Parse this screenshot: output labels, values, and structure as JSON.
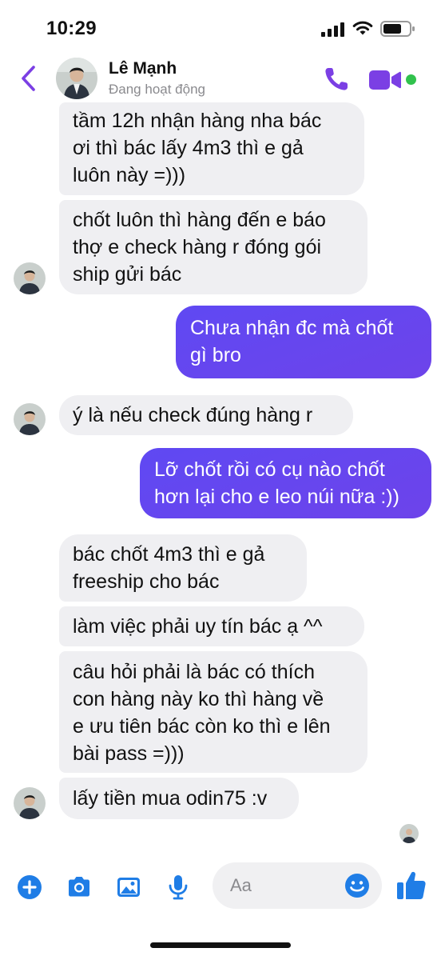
{
  "status_bar": {
    "time": "10:29"
  },
  "header": {
    "contact_name": "Lê Mạnh",
    "contact_status": "Đang hoạt động"
  },
  "messages": [
    {
      "from": "contact",
      "text": "tầm 12h nhận hàng nha bác\nơi thì bác lấy 4m3 thì e gả\nluôn này =)))"
    },
    {
      "from": "contact",
      "text": "chốt luôn thì hàng đến e báo\nthợ e check hàng r đóng gói\nship gửi bác"
    },
    {
      "from": "me",
      "text": "Chưa nhận đc mà chốt\ngì bro"
    },
    {
      "from": "contact",
      "text": "ý là nếu check đúng hàng r"
    },
    {
      "from": "me",
      "text": "Lỡ chốt rồi có cụ nào chốt\nhơn lại cho e leo núi nữa :))"
    },
    {
      "from": "contact",
      "text": "bác chốt 4m3 thì e gả\nfreeship cho bác"
    },
    {
      "from": "contact",
      "text": "làm việc phải uy tín bác ạ ^^"
    },
    {
      "from": "contact",
      "text": "câu hỏi phải là bác có thích\ncon hàng này ko thì hàng về\ne ưu tiên bác còn ko thì e lên\nbài pass =)))"
    },
    {
      "from": "contact",
      "text": "lấy tiền mua odin75 :v"
    }
  ],
  "composer": {
    "placeholder": "Aa"
  },
  "icons": {
    "back": "chevron-left-icon",
    "call": "phone-icon",
    "video": "video-camera-icon",
    "add": "plus-circle-icon",
    "camera": "camera-icon",
    "gallery": "image-icon",
    "mic": "microphone-icon",
    "emoji": "smiley-icon",
    "like": "thumbs-up-icon"
  },
  "colors": {
    "accent": "#7b3fe4",
    "outgoing_bubble": "#6046f0",
    "incoming_bubble": "#efeff2",
    "composer_blue": "#1f7de6",
    "online": "#31c24d"
  }
}
